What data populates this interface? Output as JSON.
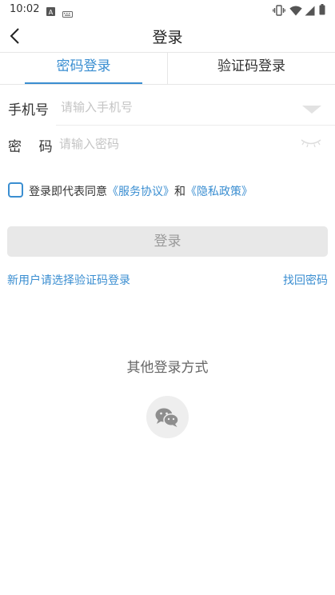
{
  "status_bar": {
    "time": "10:02",
    "icons": [
      "a-badge-icon",
      "keyboard-icon",
      "vibrate-icon",
      "wifi-icon",
      "signal-icon",
      "battery-icon"
    ]
  },
  "header": {
    "title": "登录",
    "back_icon": "chevron-left-icon"
  },
  "tabs": [
    {
      "label": "密码登录",
      "active": true
    },
    {
      "label": "验证码登录",
      "active": false
    }
  ],
  "form": {
    "phone": {
      "label": "手机号",
      "placeholder": "请输入手机号",
      "value": ""
    },
    "password": {
      "label": "密    码",
      "placeholder": "请输入密码",
      "value": ""
    }
  },
  "agreement": {
    "prefix": "登录即代表同意",
    "service_link": "《服务协议》",
    "and": "和",
    "privacy_link": "《隐私政策》",
    "checked": false
  },
  "login_button": {
    "label": "登录"
  },
  "links": {
    "new_user": "新用户请选择验证码登录",
    "forgot_password": "找回密码"
  },
  "other_login": {
    "title": "其他登录方式",
    "icon": "wechat-icon"
  },
  "colors": {
    "accent": "#3a8ed1",
    "button_disabled_bg": "#e8e8e8",
    "button_disabled_text": "#9a9a9a"
  }
}
